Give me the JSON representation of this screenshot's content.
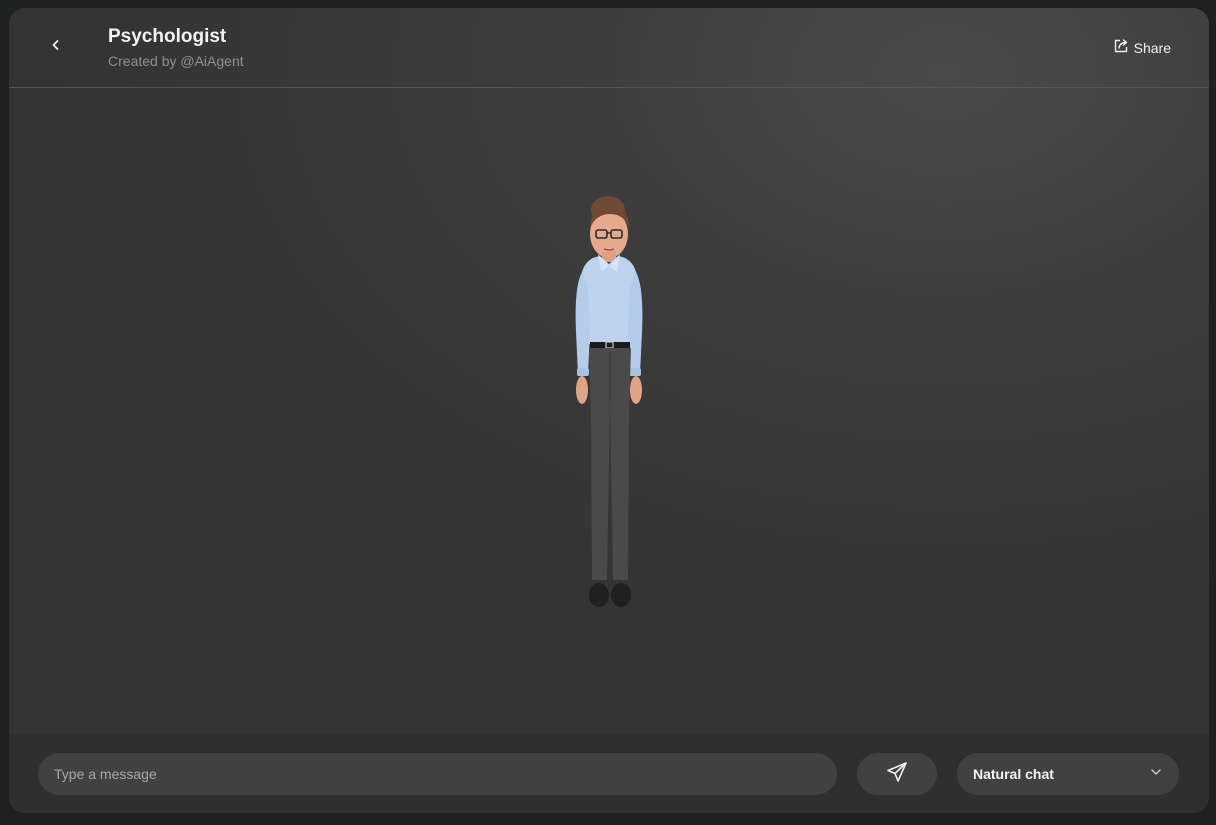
{
  "header": {
    "title": "Psychologist",
    "subtitle": "Created by @AiAgent",
    "share_label": "Share"
  },
  "icons": {
    "back": "chevron-left-icon",
    "share": "share-icon",
    "send": "send-icon",
    "dropdown": "chevron-down-icon"
  },
  "stage": {
    "avatar": "3d-avatar-psychologist"
  },
  "composer": {
    "placeholder": "Type a message",
    "value": "",
    "mode_selected": "Natural chat"
  },
  "colors": {
    "background": "#3c3c3c",
    "footer": "#2f2f2f",
    "control": "#414141",
    "text": "#f2f2f2",
    "muted": "#8f8f8f"
  }
}
